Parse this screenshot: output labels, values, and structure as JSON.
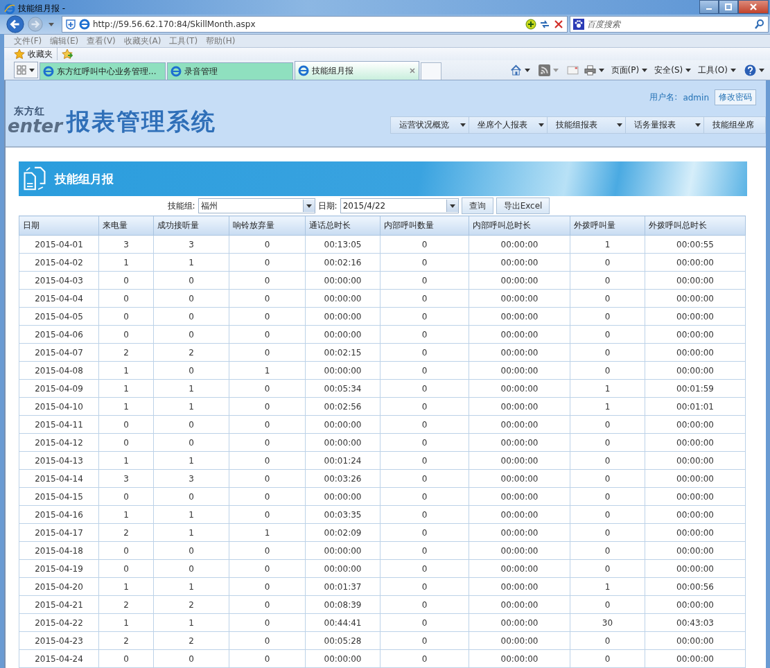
{
  "window": {
    "title": "技能组月报 -"
  },
  "address_bar": {
    "url": "http://59.56.62.170:84/SkillMonth.aspx",
    "search_placeholder": "百度搜索"
  },
  "menu_bar": [
    "文件(F)",
    "编辑(E)",
    "查看(V)",
    "收藏夹(A)",
    "工具(T)",
    "帮助(H)"
  ],
  "favorites_bar": {
    "label": "收藏夹"
  },
  "tabs": [
    {
      "label": "东方红呼叫中心业务管理...",
      "selected": false
    },
    {
      "label": "录音管理",
      "selected": false
    },
    {
      "label": "技能组月报",
      "selected": true
    }
  ],
  "command_bar": [
    "页面(P)",
    "安全(S)",
    "工具(O)"
  ],
  "header": {
    "logo_small": "东方红",
    "logo_partial": "enter",
    "system_title": "报表管理系统",
    "user_label": "用户名:",
    "user_name": "admin",
    "change_password": "修改密码",
    "nav": [
      "运营状况概览",
      "坐席个人报表",
      "技能组报表",
      "话务量报表",
      "技能组坐席"
    ]
  },
  "page_title": "技能组月报",
  "filters": {
    "group_label": "技能组:",
    "group_value": "福州",
    "date_label": "日期:",
    "date_value": "2015/4/22",
    "query_button": "查询",
    "export_button": "导出Excel"
  },
  "table": {
    "columns": [
      "日期",
      "来电量",
      "成功接听量",
      "响铃放弃量",
      "通话总时长",
      "内部呼叫数量",
      "内部呼叫总时长",
      "外拨呼叫量",
      "外拨呼叫总时长"
    ],
    "rows": [
      [
        "2015-04-01",
        "3",
        "3",
        "0",
        "00:13:05",
        "0",
        "00:00:00",
        "1",
        "00:00:55"
      ],
      [
        "2015-04-02",
        "1",
        "1",
        "0",
        "00:02:16",
        "0",
        "00:00:00",
        "0",
        "00:00:00"
      ],
      [
        "2015-04-03",
        "0",
        "0",
        "0",
        "00:00:00",
        "0",
        "00:00:00",
        "0",
        "00:00:00"
      ],
      [
        "2015-04-04",
        "0",
        "0",
        "0",
        "00:00:00",
        "0",
        "00:00:00",
        "0",
        "00:00:00"
      ],
      [
        "2015-04-05",
        "0",
        "0",
        "0",
        "00:00:00",
        "0",
        "00:00:00",
        "0",
        "00:00:00"
      ],
      [
        "2015-04-06",
        "0",
        "0",
        "0",
        "00:00:00",
        "0",
        "00:00:00",
        "0",
        "00:00:00"
      ],
      [
        "2015-04-07",
        "2",
        "2",
        "0",
        "00:02:15",
        "0",
        "00:00:00",
        "0",
        "00:00:00"
      ],
      [
        "2015-04-08",
        "1",
        "0",
        "1",
        "00:00:00",
        "0",
        "00:00:00",
        "0",
        "00:00:00"
      ],
      [
        "2015-04-09",
        "1",
        "1",
        "0",
        "00:05:34",
        "0",
        "00:00:00",
        "1",
        "00:01:59"
      ],
      [
        "2015-04-10",
        "1",
        "1",
        "0",
        "00:02:56",
        "0",
        "00:00:00",
        "1",
        "00:01:01"
      ],
      [
        "2015-04-11",
        "0",
        "0",
        "0",
        "00:00:00",
        "0",
        "00:00:00",
        "0",
        "00:00:00"
      ],
      [
        "2015-04-12",
        "0",
        "0",
        "0",
        "00:00:00",
        "0",
        "00:00:00",
        "0",
        "00:00:00"
      ],
      [
        "2015-04-13",
        "1",
        "1",
        "0",
        "00:01:24",
        "0",
        "00:00:00",
        "0",
        "00:00:00"
      ],
      [
        "2015-04-14",
        "3",
        "3",
        "0",
        "00:03:26",
        "0",
        "00:00:00",
        "0",
        "00:00:00"
      ],
      [
        "2015-04-15",
        "0",
        "0",
        "0",
        "00:00:00",
        "0",
        "00:00:00",
        "0",
        "00:00:00"
      ],
      [
        "2015-04-16",
        "1",
        "1",
        "0",
        "00:03:35",
        "0",
        "00:00:00",
        "0",
        "00:00:00"
      ],
      [
        "2015-04-17",
        "2",
        "1",
        "1",
        "00:02:09",
        "0",
        "00:00:00",
        "0",
        "00:00:00"
      ],
      [
        "2015-04-18",
        "0",
        "0",
        "0",
        "00:00:00",
        "0",
        "00:00:00",
        "0",
        "00:00:00"
      ],
      [
        "2015-04-19",
        "0",
        "0",
        "0",
        "00:00:00",
        "0",
        "00:00:00",
        "0",
        "00:00:00"
      ],
      [
        "2015-04-20",
        "1",
        "1",
        "0",
        "00:01:37",
        "0",
        "00:00:00",
        "1",
        "00:00:56"
      ],
      [
        "2015-04-21",
        "2",
        "2",
        "0",
        "00:08:39",
        "0",
        "00:00:00",
        "0",
        "00:00:00"
      ],
      [
        "2015-04-22",
        "1",
        "1",
        "0",
        "00:44:41",
        "0",
        "00:00:00",
        "30",
        "00:43:03"
      ],
      [
        "2015-04-23",
        "2",
        "2",
        "0",
        "00:05:28",
        "0",
        "00:00:00",
        "0",
        "00:00:00"
      ],
      [
        "2015-04-24",
        "0",
        "0",
        "0",
        "00:00:00",
        "0",
        "00:00:00",
        "0",
        "00:00:00"
      ]
    ]
  }
}
